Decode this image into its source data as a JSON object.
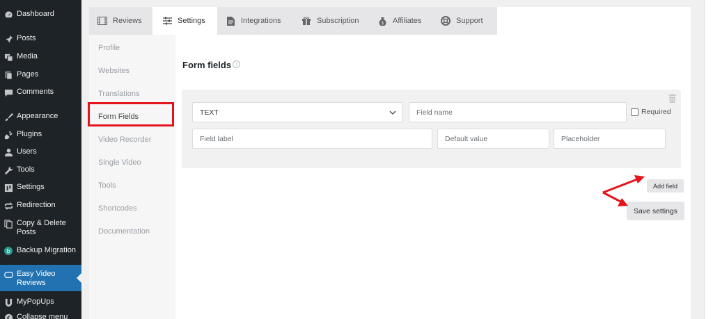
{
  "wp_menu": [
    {
      "label": "Dashboard",
      "icon": "dashboard-icon"
    },
    {
      "label": "Posts",
      "icon": "pin-icon"
    },
    {
      "label": "Media",
      "icon": "media-icon"
    },
    {
      "label": "Pages",
      "icon": "pages-icon"
    },
    {
      "label": "Comments",
      "icon": "comment-icon"
    },
    {
      "label": "Appearance",
      "icon": "brush-icon"
    },
    {
      "label": "Plugins",
      "icon": "plugin-icon"
    },
    {
      "label": "Users",
      "icon": "user-icon"
    },
    {
      "label": "Tools",
      "icon": "wrench-icon"
    },
    {
      "label": "Settings",
      "icon": "settings-icon"
    },
    {
      "label": "Redirection",
      "icon": "redirect-icon"
    },
    {
      "label": "Copy & Delete Posts",
      "icon": "copy-icon"
    },
    {
      "label": "Backup Migration",
      "icon": "backup-icon"
    },
    {
      "label": "Easy Video Reviews",
      "icon": "video-icon",
      "active": true
    },
    {
      "label": "MyPopUps",
      "icon": "popup-icon"
    },
    {
      "label": "Collapse menu",
      "icon": "collapse-icon"
    }
  ],
  "tabs": [
    {
      "label": "Reviews",
      "icon": "film-icon"
    },
    {
      "label": "Settings",
      "icon": "sliders-icon",
      "active": true
    },
    {
      "label": "Integrations",
      "icon": "document-icon"
    },
    {
      "label": "Subscription",
      "icon": "gift-icon"
    },
    {
      "label": "Affiliates",
      "icon": "moneybag-icon"
    },
    {
      "label": "Support",
      "icon": "lifebuoy-icon"
    }
  ],
  "subnav": [
    "Profile",
    "Websites",
    "Translations",
    "Form Fields",
    "Video Recorder",
    "Single Video",
    "Tools",
    "Shortcodes",
    "Documentation"
  ],
  "subnav_active": "Form Fields",
  "form": {
    "title": "Form fields",
    "info_glyph": "i",
    "type_value": "TEXT",
    "field_name_placeholder": "Field name",
    "required_label": "Required",
    "field_label_placeholder": "Field label",
    "default_value_placeholder": "Default value",
    "placeholder_placeholder": "Placeholder"
  },
  "buttons": {
    "add_field": "Add field",
    "save_settings": "Save settings"
  },
  "colors": {
    "wp_sidebar": "#1d2327",
    "wp_active": "#2271b1",
    "highlight_red": "#e3141b"
  }
}
